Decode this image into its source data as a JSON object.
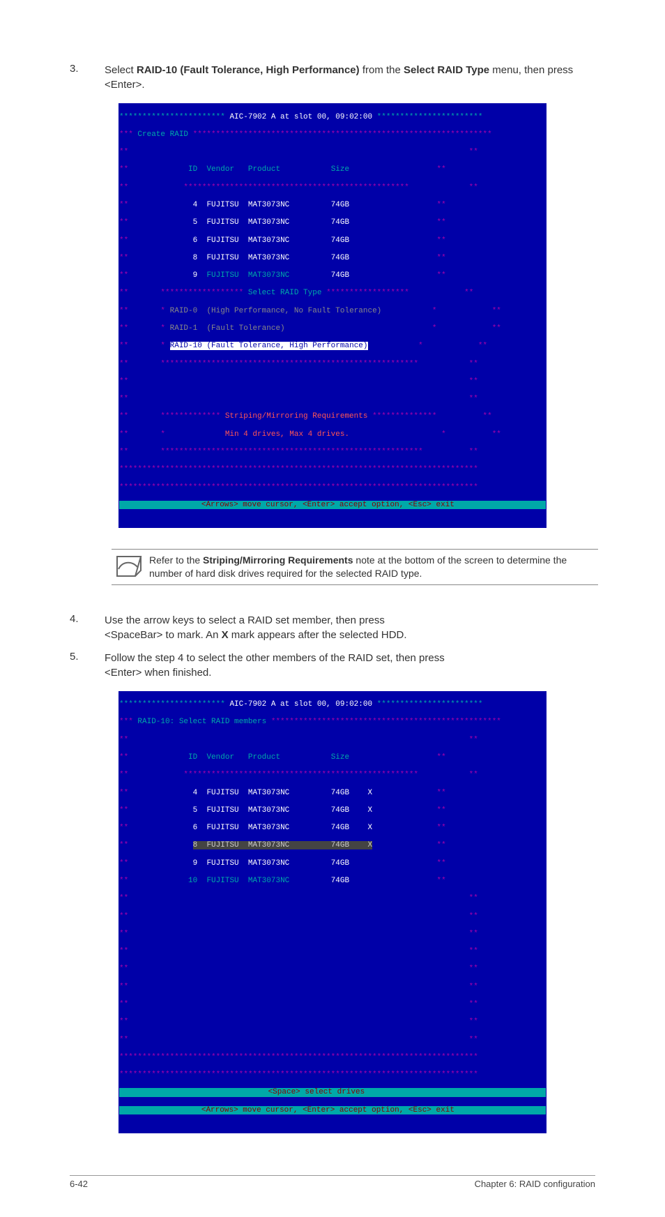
{
  "steps": {
    "s3": {
      "num": "3.",
      "prefix": "Select ",
      "bold1": "RAID-10 (Fault Tolerance, High Performance)",
      "mid": " from the ",
      "bold2": "Select RAID Type",
      "suffix": " menu, then press <Enter>."
    },
    "s4": {
      "num": "4.",
      "line1": "Use the arrow keys to select a RAID set member, then press",
      "line2_pre": "<SpaceBar> to mark. An ",
      "line2_bold": "X",
      "line2_post": " mark appears after the selected HDD."
    },
    "s5": {
      "num": "5.",
      "line1": "Follow the step 4 to select the other members of the RAID set, then press",
      "line2": "<Enter> when finished."
    }
  },
  "note": {
    "pre": "Refer to the ",
    "bold": "Striping/Mirroring Requirements",
    "post": " note at the bottom of the screen to determine the number of hard disk drives required for the selected RAID type."
  },
  "term1": {
    "title": "AIC-7902 A at slot 00, 09:02:00",
    "menu": "Create RAID",
    "headers": {
      "id": "ID",
      "vendor": "Vendor",
      "product": "Product",
      "size": "Size"
    },
    "drives": [
      {
        "id": "4",
        "vendor": "FUJITSU",
        "product": "MAT3073NC",
        "size": "74GB"
      },
      {
        "id": "5",
        "vendor": "FUJITSU",
        "product": "MAT3073NC",
        "size": "74GB"
      },
      {
        "id": "6",
        "vendor": "FUJITSU",
        "product": "MAT3073NC",
        "size": "74GB"
      },
      {
        "id": "8",
        "vendor": "FUJITSU",
        "product": "MAT3073NC",
        "size": "74GB"
      },
      {
        "id": "9",
        "vendor": "FUJITSU",
        "product": "MAT3073NC",
        "size": "74GB"
      }
    ],
    "select_title": "Select RAID Type",
    "raid_options": [
      {
        "name": "RAID-0",
        "desc": "(High Performance, No Fault Tolerance)"
      },
      {
        "name": "RAID-1",
        "desc": "(Fault Tolerance)"
      },
      {
        "name": "RAID-10",
        "desc": "(Fault Tolerance, High Performance)"
      }
    ],
    "req_title": "Striping/Mirroring Requirements",
    "req_text": "Min 4 drives, Max 4 drives.",
    "footer": "<Arrows> move cursor, <Enter> accept option, <Esc> exit"
  },
  "term2": {
    "title": "AIC-7902 A at slot 00, 09:02:00",
    "menu": "RAID-10: Select RAID members",
    "headers": {
      "id": "ID",
      "vendor": "Vendor",
      "product": "Product",
      "size": "Size"
    },
    "drives": [
      {
        "id": "4",
        "vendor": "FUJITSU",
        "product": "MAT3073NC",
        "size": "74GB",
        "mark": "X"
      },
      {
        "id": "5",
        "vendor": "FUJITSU",
        "product": "MAT3073NC",
        "size": "74GB",
        "mark": "X"
      },
      {
        "id": "6",
        "vendor": "FUJITSU",
        "product": "MAT3073NC",
        "size": "74GB",
        "mark": "X"
      },
      {
        "id": "8",
        "vendor": "FUJITSU",
        "product": "MAT3073NC",
        "size": "74GB",
        "mark": "X"
      },
      {
        "id": "9",
        "vendor": "FUJITSU",
        "product": "MAT3073NC",
        "size": "74GB",
        "mark": ""
      },
      {
        "id": "10",
        "vendor": "FUJITSU",
        "product": "MAT3073NC",
        "size": "74GB",
        "mark": ""
      }
    ],
    "space_hint": "<Space> select drives",
    "footer": "<Arrows> move cursor, <Enter> accept option, <Esc> exit"
  },
  "pagefoot": {
    "left": "6-42",
    "right": "Chapter 6: RAID configuration"
  }
}
